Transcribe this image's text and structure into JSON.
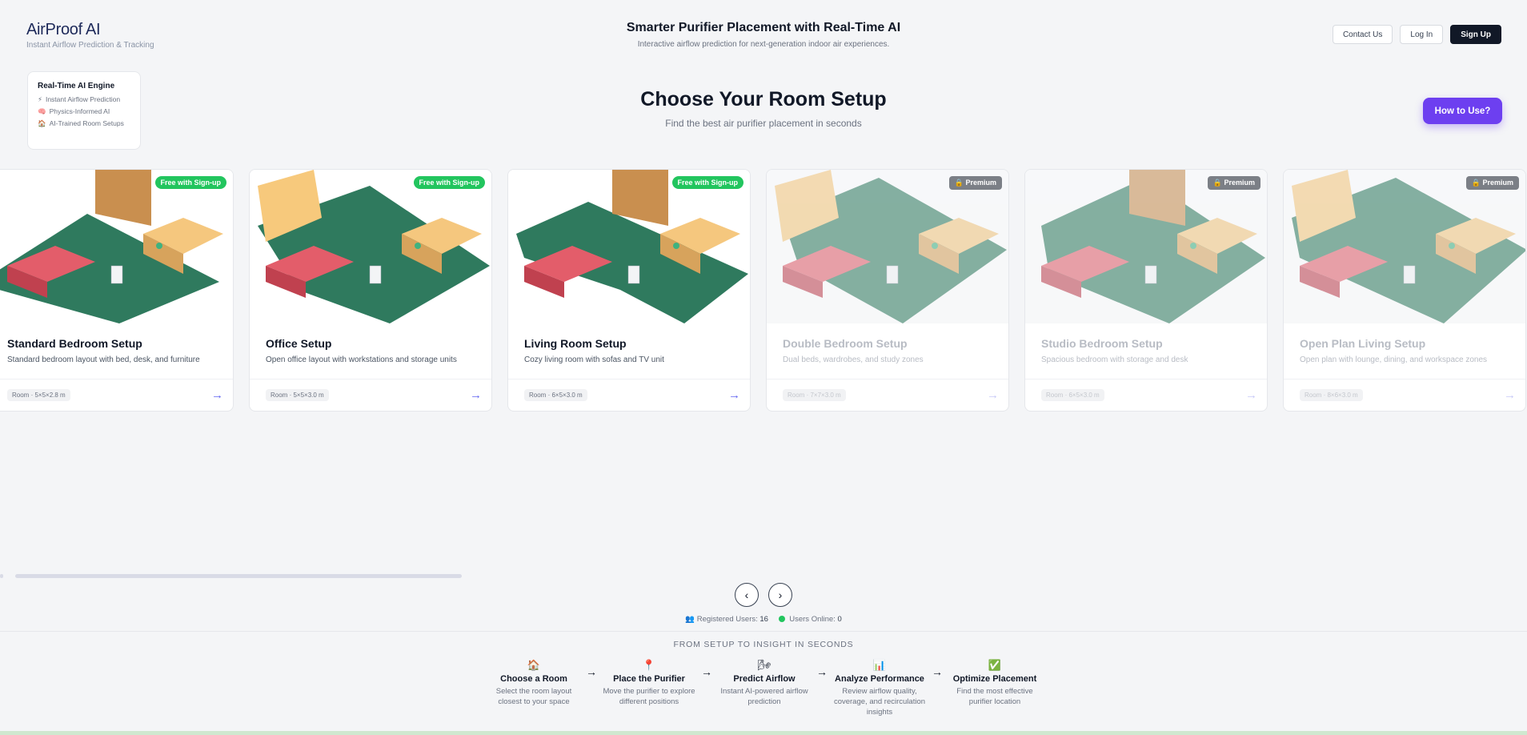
{
  "brand": {
    "title": "AirProof AI",
    "subtitle": "Instant Airflow Prediction & Tracking"
  },
  "hero": {
    "title": "Smarter Purifier Placement with Real-Time AI",
    "subtitle": "Interactive airflow prediction for next-generation indoor air experiences."
  },
  "nav": {
    "contact": "Contact Us",
    "login": "Log In",
    "signup": "Sign Up"
  },
  "engine": {
    "title": "Real-Time AI Engine",
    "items": [
      {
        "icon": "⚡",
        "label": "Instant Airflow Prediction"
      },
      {
        "icon": "🧠",
        "label": "Physics-Informed AI"
      },
      {
        "icon": "🏠",
        "label": "AI-Trained Room Setups"
      }
    ]
  },
  "main": {
    "title": "Choose Your Room Setup",
    "subtitle": "Find the best air purifier placement in seconds",
    "howto": "How to Use?"
  },
  "cards": [
    {
      "name": "Standard Bedroom Setup",
      "desc": "Standard bedroom layout with bed, desk, and furniture",
      "room": "Room · 5×5×2.8 m",
      "badge": "Free with Sign-up",
      "premium": false
    },
    {
      "name": "Office Setup",
      "desc": "Open office layout with workstations and storage units",
      "room": "Room · 5×5×3.0 m",
      "badge": "Free with Sign-up",
      "premium": false
    },
    {
      "name": "Living Room Setup",
      "desc": "Cozy living room with sofas and TV unit",
      "room": "Room · 6×5×3.0 m",
      "badge": "Free with Sign-up",
      "premium": false
    },
    {
      "name": "Double Bedroom Setup",
      "desc": "Dual beds, wardrobes, and study zones",
      "room": "Room · 7×7×3.0 m",
      "badge": "🔒 Premium",
      "premium": true
    },
    {
      "name": "Studio Bedroom Setup",
      "desc": "Spacious bedroom with storage and desk",
      "room": "Room · 6×5×3.0 m",
      "badge": "🔒 Premium",
      "premium": true
    },
    {
      "name": "Open Plan Living Setup",
      "desc": "Open plan with lounge, dining, and workspace zones",
      "room": "Room · 8×6×3.0 m",
      "badge": "🔒 Premium",
      "premium": true
    }
  ],
  "pager": {
    "prev": "‹",
    "next": "›"
  },
  "stats": {
    "users_label": "Registered Users:",
    "users_value": "16",
    "online_label": "Users Online:",
    "online_value": "0",
    "users_icon": "👥"
  },
  "steps_header": "FROM SETUP TO INSIGHT IN SECONDS",
  "steps": [
    {
      "icon": "🏠",
      "title": "Choose a Room",
      "desc": "Select the room layout closest to your space"
    },
    {
      "icon": "📍",
      "title": "Place the Purifier",
      "desc": "Move the purifier to explore different positions"
    },
    {
      "icon": "🌬",
      "title": "Predict Airflow",
      "desc": "Instant AI-powered airflow prediction"
    },
    {
      "icon": "📊",
      "title": "Analyze Performance",
      "desc": "Review airflow quality, coverage, and recirculation insights"
    },
    {
      "icon": "✅",
      "title": "Optimize Placement",
      "desc": "Find the most effective purifier location"
    }
  ],
  "colors": {
    "accent": "#6d3ff0",
    "free_badge": "#22c55e",
    "floor": "#2f7a5e",
    "wood": "#f5c77e",
    "bed": "#e35d6a"
  }
}
